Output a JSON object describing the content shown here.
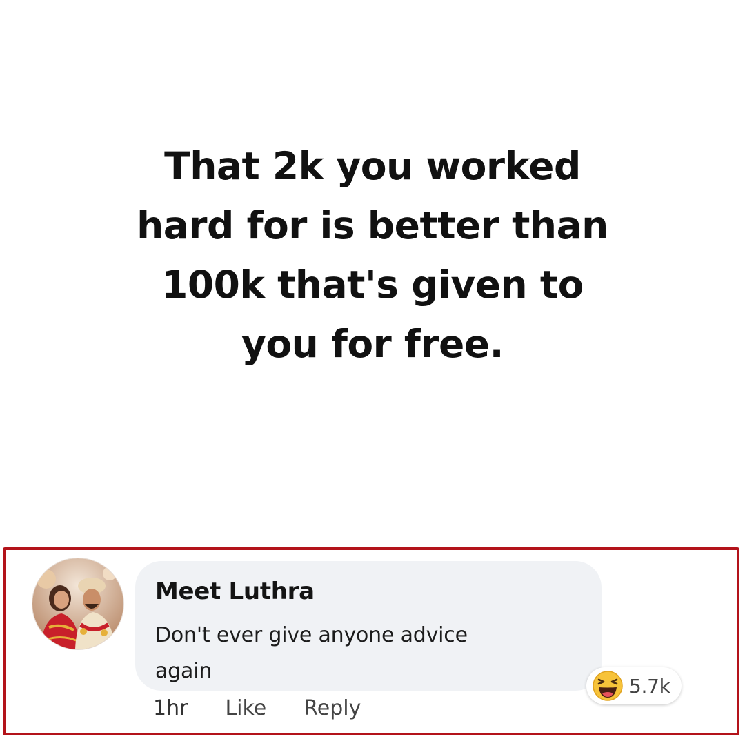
{
  "quote": {
    "lines": [
      "That 2k you worked",
      "hard for is better than",
      "100k that's given to",
      "you for free."
    ]
  },
  "comment": {
    "author": "Meet Luthra",
    "text_lines": [
      "Don't ever give anyone advice",
      "again"
    ],
    "time": "1hr",
    "like_label": "Like",
    "reply_label": "Reply",
    "reaction": {
      "icon": "haha-emoji-icon",
      "count": "5.7k"
    }
  },
  "colors": {
    "frame_border": "#b3131a",
    "bubble_bg": "#f0f2f5",
    "haha_yellow": "#f7c33a"
  }
}
